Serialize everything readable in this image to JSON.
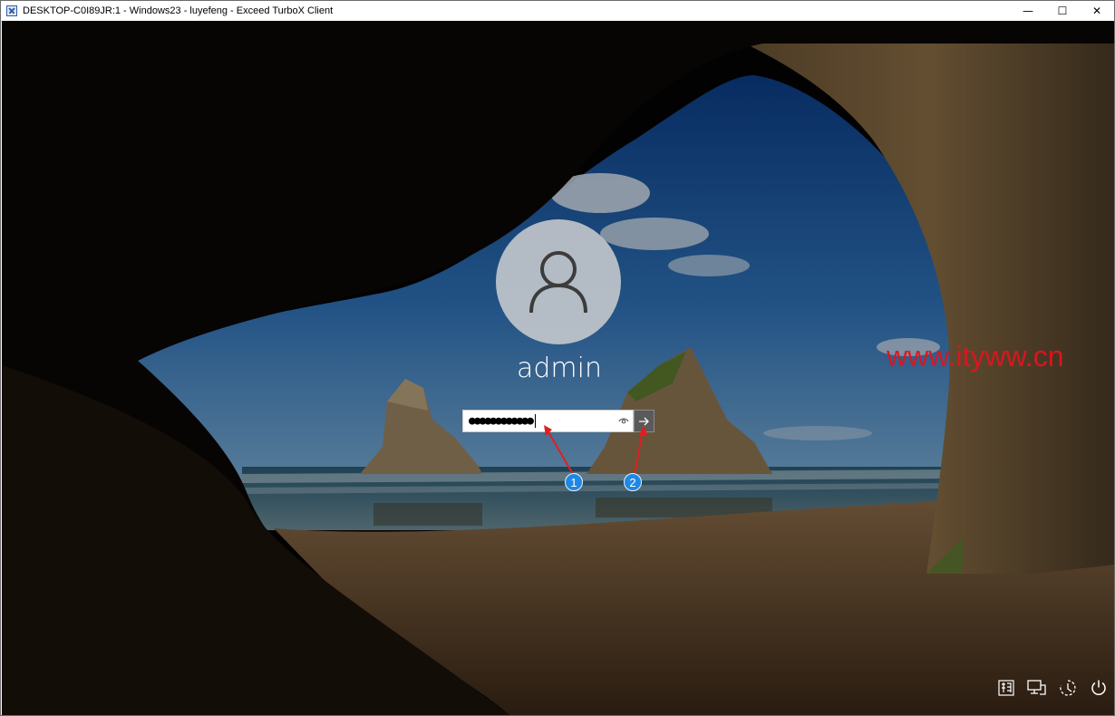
{
  "window": {
    "title": "DESKTOP-C0I89JR:1 - Windows23 - luyefeng - Exceed TurboX Client",
    "icon": "app-x-icon",
    "controls": {
      "minimize": "—",
      "maximize": "☐",
      "close": "✕"
    }
  },
  "login": {
    "avatar_icon": "user-icon",
    "username": "admin",
    "password_mask": "●●●●●●●●●●●●",
    "reveal_icon": "eye-icon",
    "submit_icon": "arrow-right-icon"
  },
  "annotations": [
    {
      "number": "1",
      "color": "#1e88e5"
    },
    {
      "number": "2",
      "color": "#1e88e5"
    }
  ],
  "watermark": "www.ityww.cn",
  "tray": {
    "items": [
      "input-method-icon",
      "network-icon",
      "ease-of-access-icon",
      "power-icon"
    ]
  }
}
